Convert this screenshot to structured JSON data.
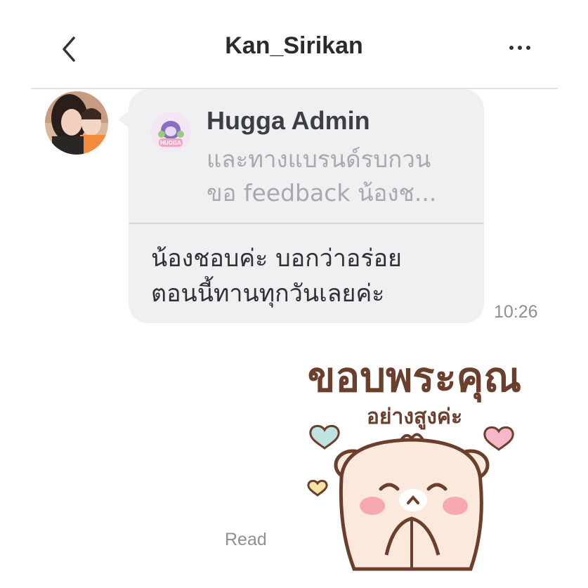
{
  "header": {
    "title": "Kan_Sirikan",
    "back_icon": "chevron-left-icon",
    "more_icon": "more-horizontal-icon"
  },
  "message": {
    "quote": {
      "name": "Hugga Admin",
      "text_lines": [
        "และทางแบรนด์รบกวน",
        "ขอ feedback น้องช..."
      ]
    },
    "reply_lines": [
      "น้องชอบค่ะ บอกว่าอร่อย",
      "ตอนนี้ทานทุกวันเลยค่ะ"
    ],
    "time": "10:26"
  },
  "sticker": {
    "line1": "ขอบพระคุณ",
    "line2": "อย่างสูงค่ะ",
    "colors": {
      "outline": "#6b3f2c",
      "body": "#fbe9dd",
      "cheek": "#f7a9b0"
    }
  },
  "status": {
    "read": "Read"
  }
}
